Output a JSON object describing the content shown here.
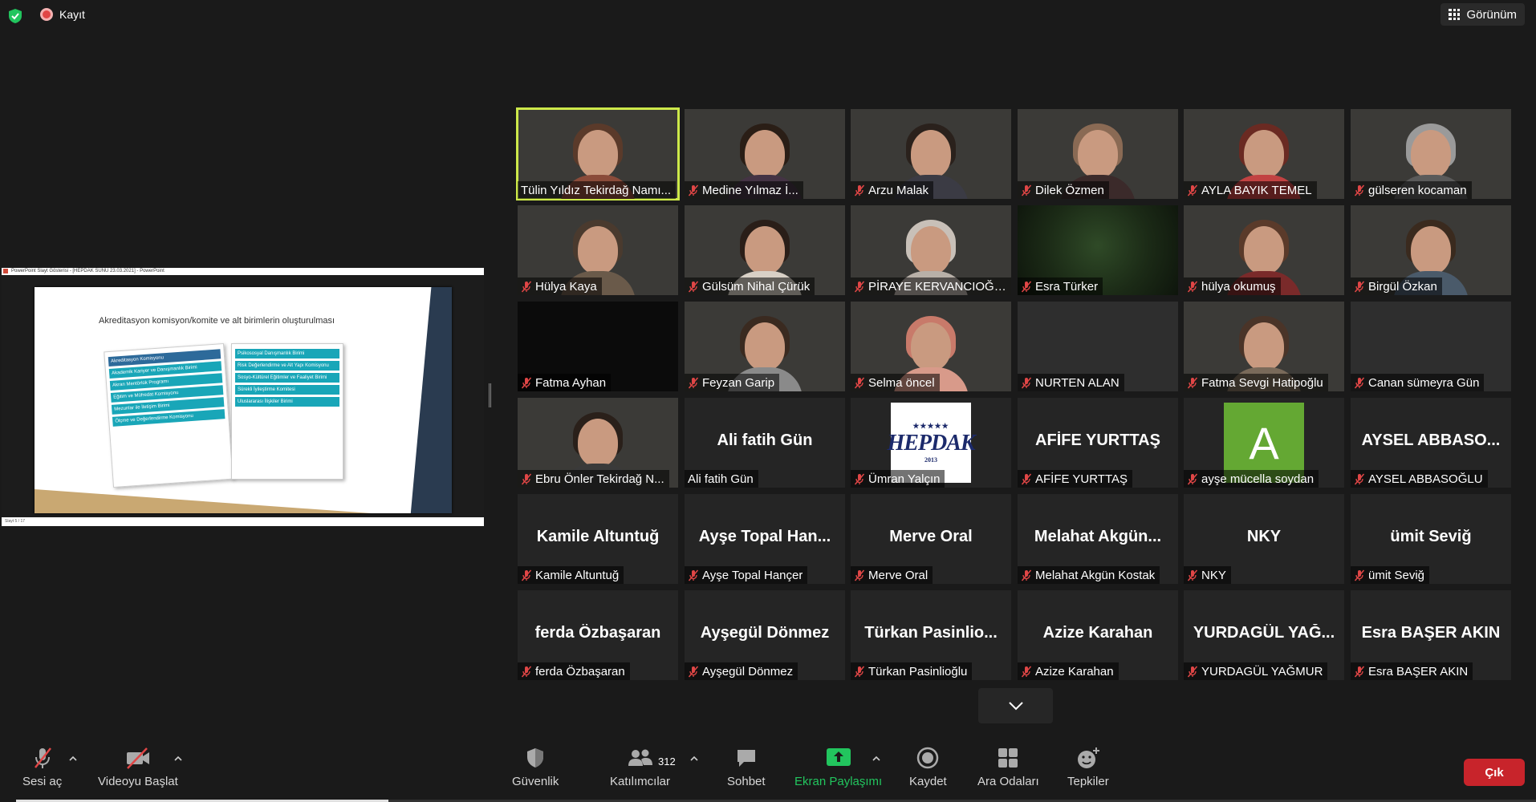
{
  "topbar": {
    "record_label": "Kayıt",
    "view_label": "Görünüm"
  },
  "share": {
    "window_title": "PowerPoint Slayt Gösterisi - [HEPDAK SUNU 23.03.2021] - PowerPoint",
    "slide_title": "Akreditasyon komisyon/komite ve alt birimlerin oluşturulması",
    "left_items": [
      "Akreditasyon Komisyonu",
      "Akademik Kariyer ve Danışmanlık Birimi",
      "Akran Mentörlük Programı",
      "Eğitim ve Müfredat Komisyonu",
      "Mezunlar ile İletişim Birimi",
      "Ölçme ve Değerlendirme Komisyonu"
    ],
    "right_items": [
      "Psikososyal Danışmanlık Birimi",
      "Risk Değerlendirme ve Alt Yapı Komisyonu",
      "Sosyo-Kültürel Eğitimler ve Faaliyet Birimi",
      "Sürekli İyileştirme Komitesi",
      "Uluslararası İlişkiler Birimi"
    ],
    "footer_text": "Slayt 5 / 17"
  },
  "participants": [
    {
      "name": "Tülin Yıldız Tekirdağ Namı...",
      "kind": "video",
      "active": true,
      "muted": false,
      "hair": "#5a3a2a",
      "shirt": "#8a4b3a"
    },
    {
      "name": "Medine Yılmaz İ...",
      "kind": "video",
      "muted": true,
      "hair": "#2a1e16",
      "shirt": "#443344"
    },
    {
      "name": "Arzu Malak",
      "kind": "video",
      "muted": true,
      "hair": "#2a211c",
      "shirt": "#3b3b44"
    },
    {
      "name": "Dilek Özmen",
      "kind": "video",
      "muted": true,
      "hair": "#8a6a54",
      "shirt": "#3b2a2a"
    },
    {
      "name": "AYLA BAYIK TEMEL",
      "kind": "video",
      "muted": true,
      "hair": "#6a2a22",
      "shirt": "#c24242"
    },
    {
      "name": "gülseren kocaman",
      "kind": "video",
      "muted": true,
      "hair": "#9a9a9a",
      "shirt": "#5a5a5a"
    },
    {
      "name": "Hülya Kaya",
      "kind": "video",
      "muted": true,
      "hair": "#4a3a2e",
      "shirt": "#6a5a4a"
    },
    {
      "name": "Gülsüm Nihal Çürük",
      "kind": "video",
      "muted": true,
      "hair": "#2a1e18",
      "shirt": "#d8d0c6"
    },
    {
      "name": "PİRAYE KERVANCIOĞLU",
      "kind": "video",
      "muted": true,
      "hair": "#c8c0b8",
      "shirt": "#b8b0a8"
    },
    {
      "name": "Esra Türker",
      "kind": "green",
      "muted": true
    },
    {
      "name": "hülya okumuş",
      "kind": "video",
      "muted": true,
      "hair": "#5a3a2a",
      "shirt": "#7a2a2a"
    },
    {
      "name": "Birgül Özkan",
      "kind": "video",
      "muted": true,
      "hair": "#3a2a1e",
      "shirt": "#4a5a6a"
    },
    {
      "name": "Fatma Ayhan",
      "kind": "dark",
      "muted": true
    },
    {
      "name": "Feyzan Garip",
      "kind": "video",
      "muted": true,
      "hair": "#3a2a20",
      "shirt": "#8a8a8a"
    },
    {
      "name": "Selma öncel",
      "kind": "video",
      "muted": true,
      "hair": "#c87a6a",
      "shirt": "#d89a8a"
    },
    {
      "name": "NURTEN ALAN",
      "kind": "gray",
      "muted": true
    },
    {
      "name": "Fatma Sevgi Hatipoğlu",
      "kind": "video",
      "muted": true,
      "hair": "#4a3428",
      "shirt": "#7a6a5a"
    },
    {
      "name": "Canan sümeyra Gün",
      "kind": "gray",
      "muted": true
    },
    {
      "name": "Ebru Önler Tekirdağ N...",
      "kind": "video",
      "muted": true,
      "hair": "#2a201a",
      "shirt": "#3a3a3a"
    },
    {
      "name": "Ali fatih Gün",
      "kind": "text",
      "muted": false,
      "display": "Ali fatih Gün"
    },
    {
      "name": "Ümran Yalçın",
      "kind": "logo",
      "muted": true,
      "logo_text": "HEPDAK",
      "logo_year": "2013"
    },
    {
      "name": "AFİFE YURTTAŞ",
      "kind": "text",
      "muted": true,
      "display": "AFİFE YURTTAŞ"
    },
    {
      "name": "ayşe mücella soydan",
      "kind": "avatar",
      "muted": true,
      "initial": "A"
    },
    {
      "name": "AYSEL ABBASOĞLU",
      "kind": "text",
      "muted": true,
      "display": "AYSEL  ABBASO..."
    },
    {
      "name": "Kamile Altuntuğ",
      "kind": "text",
      "muted": true,
      "display": "Kamile Altuntuğ"
    },
    {
      "name": "Ayşe Topal Hançer",
      "kind": "text",
      "muted": true,
      "display": "Ayşe  Topal  Han..."
    },
    {
      "name": "Merve Oral",
      "kind": "text",
      "muted": true,
      "display": "Merve Oral"
    },
    {
      "name": "Melahat Akgün Kostak",
      "kind": "text",
      "muted": true,
      "display": "Melahat  Akgün..."
    },
    {
      "name": "NKY",
      "kind": "text",
      "muted": true,
      "display": "NKY"
    },
    {
      "name": "ümit Seviğ",
      "kind": "text",
      "muted": true,
      "display": "ümit Seviğ"
    },
    {
      "name": "ferda Özbaşaran",
      "kind": "text",
      "muted": true,
      "display": "ferda Özbaşaran"
    },
    {
      "name": "Ayşegül Dönmez",
      "kind": "text",
      "muted": true,
      "display": "Ayşegül Dönmez"
    },
    {
      "name": "Türkan Pasinlioğlu",
      "kind": "text",
      "muted": true,
      "display": "Türkan  Pasinlio..."
    },
    {
      "name": "Azize Karahan",
      "kind": "text",
      "muted": true,
      "display": "Azize Karahan"
    },
    {
      "name": "YURDAGÜL YAĞMUR",
      "kind": "text",
      "muted": true,
      "display": "YURDAGÜL  YAĞ..."
    },
    {
      "name": "Esra BAŞER AKIN",
      "kind": "text",
      "muted": true,
      "display": "Esra BAŞER AKIN"
    }
  ],
  "toolbar": {
    "unmute_label": "Sesi aç",
    "start_video_label": "Videoyu Başlat",
    "security_label": "Güvenlik",
    "participants_label": "Katılımcılar",
    "participants_count": "312",
    "chat_label": "Sohbet",
    "share_label": "Ekran Paylaşımı",
    "record_label": "Kaydet",
    "breakout_label": "Ara Odaları",
    "reactions_label": "Tepkiler",
    "leave_label": "Çık"
  },
  "colors": {
    "active_speaker": "#cde94a",
    "share_green": "#22c55e",
    "leave_red": "#c8242b",
    "muted_red": "#e04646"
  }
}
